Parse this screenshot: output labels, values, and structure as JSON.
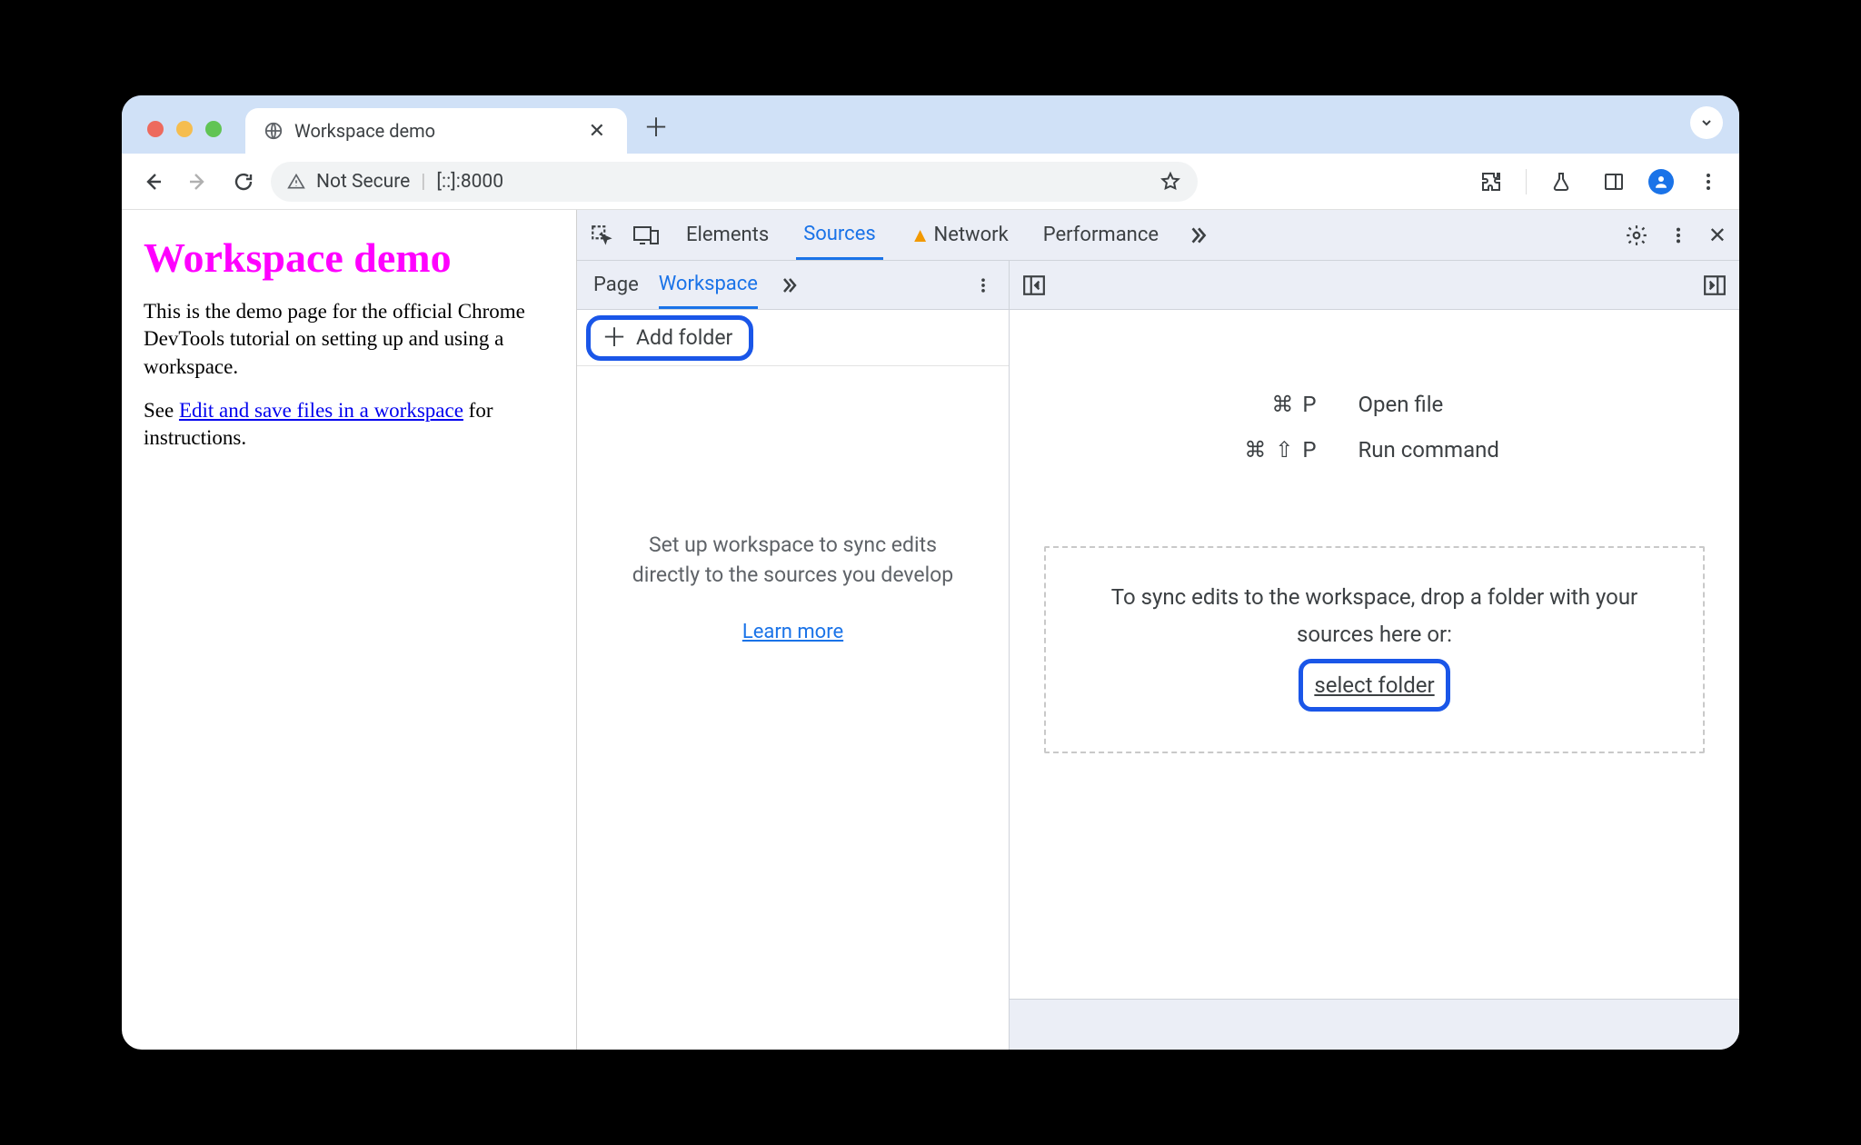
{
  "browser": {
    "tab_title": "Workspace demo",
    "omnibox": {
      "security_label": "Not Secure",
      "url": "[::]:8000"
    }
  },
  "page": {
    "heading": "Workspace demo",
    "para1": "This is the demo page for the official Chrome DevTools tutorial on setting up and using a workspace.",
    "para2_prefix": "See ",
    "para2_link": "Edit and save files in a workspace",
    "para2_suffix": " for instructions."
  },
  "devtools": {
    "top_tabs": {
      "elements": "Elements",
      "sources": "Sources",
      "network": "Network",
      "performance": "Performance"
    },
    "sub_tabs": {
      "page": "Page",
      "workspace": "Workspace"
    },
    "add_folder": "Add folder",
    "ws_blurb": "Set up workspace to sync edits directly to the sources you develop",
    "learn_more": "Learn more",
    "commands": {
      "open_keys": "⌘ P",
      "open_label": "Open file",
      "run_keys": "⌘ ⇧ P",
      "run_label": "Run command"
    },
    "dropzone_text": "To sync edits to the workspace, drop a folder with your sources here or:",
    "select_folder": "select folder"
  }
}
